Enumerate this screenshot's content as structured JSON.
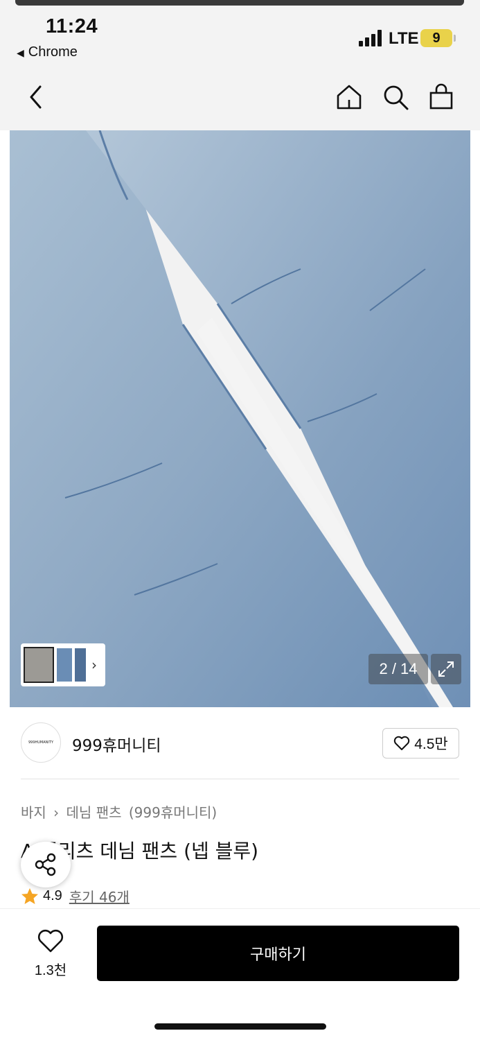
{
  "status": {
    "time": "11:24",
    "back_app": "Chrome",
    "network": "LTE",
    "battery": "9"
  },
  "nav": {
    "back_icon": "chevron-left-icon",
    "home_icon": "home-icon",
    "search_icon": "search-icon",
    "cart_icon": "shopping-bag-icon"
  },
  "gallery": {
    "counter": "2 / 14",
    "image_subject": "light blue washed denim pants with knee panels",
    "colors": {
      "denim": "#7f9fbf",
      "denim_light": "#a9bfd3"
    }
  },
  "brand": {
    "logo_text": "999HUMANITY",
    "name": "999휴머니티",
    "follow_count": "4.5만"
  },
  "product": {
    "breadcrumb": [
      "바지",
      "데님 팬츠",
      "(999휴머니티)"
    ],
    "title": "A  플리츠 데님 팬츠 (넵 블루)",
    "rating": "4.9",
    "reviews": "후기 46개"
  },
  "bottom": {
    "like_count": "1.3천",
    "buy_label": "구매하기"
  }
}
